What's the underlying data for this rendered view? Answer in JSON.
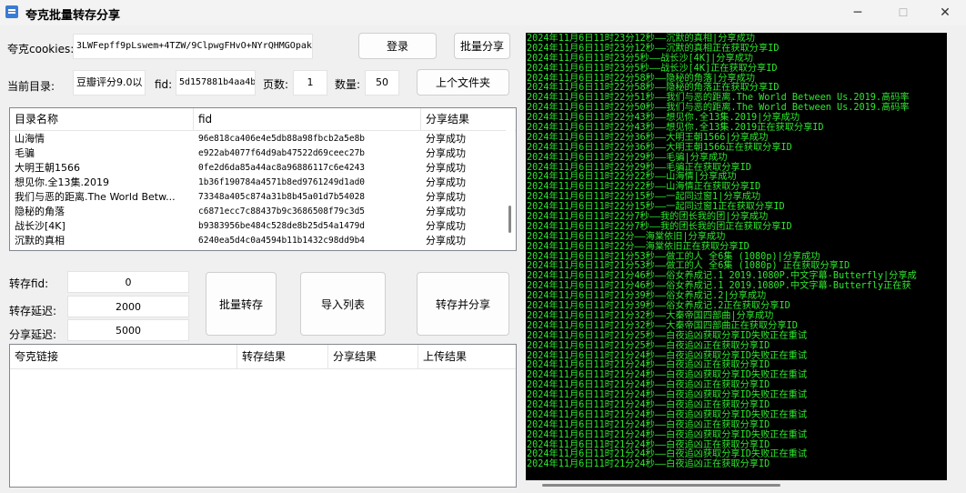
{
  "window": {
    "title": "夸克批量转存分享",
    "minimize": "─",
    "maximize": "☐",
    "close": "✕"
  },
  "login": {
    "cookies_label": "夸克cookies:",
    "cookies_value": "3LWFepff9pLswem+4TZW/9ClpwgFHvO+NYrQHMGOpak",
    "login_button": "登录",
    "batch_share_button": "批量分享"
  },
  "dir": {
    "current_label": "当前目录:",
    "current_value": "豆瓣评分9.0以",
    "fid_label": "fid:",
    "fid_value": "5d157881b4aa4b",
    "pages_label": "页数:",
    "pages_value": "1",
    "count_label": "数量:",
    "count_value": "50",
    "parent_button": "上个文件夹"
  },
  "file_table": {
    "headers": [
      "目录名称",
      "fid",
      "分享结果"
    ],
    "rows": [
      {
        "name": "山海情",
        "fid": "96e818ca406e4e5db88a98fbcb2a5e8b",
        "result": "分享成功"
      },
      {
        "name": "毛骗",
        "fid": "e922ab4077f64d9ab47522d69ceec27b",
        "result": "分享成功"
      },
      {
        "name": "大明王朝1566",
        "fid": "0fe2d6da85a44ac8a96886117c6e4243",
        "result": "分享成功"
      },
      {
        "name": "想见你.全13集.2019",
        "fid": "1b36f190784a4571b8ed9761249d1ad0",
        "result": "分享成功"
      },
      {
        "name": "我们与恶的距离.The World Betw...",
        "fid": "73348a405c874a31b8b45a01d7b54028",
        "result": "分享成功"
      },
      {
        "name": "隐秘的角落",
        "fid": "c6871ecc7c88437b9c3686508f79c3d5",
        "result": "分享成功"
      },
      {
        "name": "战长沙[4K]",
        "fid": "b9383956be484c528de8b25d54a1479d",
        "result": "分享成功"
      },
      {
        "name": "沉默的真相",
        "fid": "6240ea5d4c0a4594b11b1432c98dd9b4",
        "result": "分享成功"
      }
    ]
  },
  "transfer": {
    "fid_label": "转存fid:",
    "fid_value": "0",
    "delay_label": "转存延迟:",
    "delay_value": "2000",
    "share_delay_label": "分享延迟:",
    "share_delay_value": "5000",
    "batch_transfer_button": "批量转存",
    "import_button": "导入列表",
    "transfer_share_button": "转存并分享"
  },
  "link_table": {
    "headers": [
      "夸克链接",
      "转存结果",
      "分享结果",
      "上传结果"
    ]
  },
  "log": [
    "2024年11月6日11时23分12秒——沉默的真相|分享成功",
    "2024年11月6日11时23分12秒——沉默的真相正在获取分享ID",
    "2024年11月6日11时23分5秒——战长沙[4K]|分享成功",
    "2024年11月6日11时23分5秒——战长沙[4K]正在获取分享ID",
    "2024年11月6日11时22分58秒——隐秘的角落|分享成功",
    "2024年11月6日11时22分58秒——隐秘的角落正在获取分享ID",
    "2024年11月6日11时22分51秒——我们与恶的距离.The World Between Us.2019.高码率",
    "2024年11月6日11时22分50秒——我们与恶的距离.The World Between Us.2019.高码率",
    "2024年11月6日11时22分43秒——想见你.全13集.2019|分享成功",
    "2024年11月6日11时22分43秒——想见你.全13集.2019正在获取分享ID",
    "2024年11月6日11时22分36秒——大明王朝1566|分享成功",
    "2024年11月6日11时22分36秒——大明王朝1566正在获取分享ID",
    "2024年11月6日11时22分29秒——毛骗|分享成功",
    "2024年11月6日11时22分29秒——毛骗正在获取分享ID",
    "2024年11月6日11时22分22秒——山海情|分享成功",
    "2024年11月6日11时22分22秒——山海情正在获取分享ID",
    "2024年11月6日11时22分15秒——一起同过窗1|分享成功",
    "2024年11月6日11时22分15秒——一起同过窗1正在获取分享ID",
    "2024年11月6日11时22分7秒——我的团长我的团|分享成功",
    "2024年11月6日11时22分7秒——我的团长我的团正在获取分享ID",
    "2024年11月6日11时22分——海棠依旧|分享成功",
    "2024年11月6日11时22分——海棠依旧正在获取分享ID",
    "2024年11月6日11时21分53秒——做工的人 全6集 (1080p)|分享成功",
    "2024年11月6日11时21分53秒——做工的人 全6集 (1080p) 正在获取分享ID",
    "2024年11月6日11时21分46秒——俗女养成记.1 2019.1080P.中文字幕-Butterfly|分享成",
    "2024年11月6日11时21分46秒——俗女养成记.1 2019.1080P.中文字幕-Butterfly正在获",
    "2024年11月6日11时21分39秒——俗女养成记.2|分享成功",
    "2024年11月6日11时21分39秒——俗女养成记.2正在获取分享ID",
    "2024年11月6日11时21分32秒——大秦帝国四部曲|分享成功",
    "2024年11月6日11时21分32秒——大秦帝国四部曲正在获取分享ID",
    "2024年11月6日11时21分25秒——白夜追凶获取分享ID失败正在重试",
    "2024年11月6日11时21分25秒——白夜追凶正在获取分享ID",
    "2024年11月6日11时21分24秒——白夜追凶获取分享ID失败正在重试",
    "2024年11月6日11时21分24秒——白夜追凶正在获取分享ID",
    "2024年11月6日11时21分24秒——白夜追凶获取分享ID失败正在重试",
    "2024年11月6日11时21分24秒——白夜追凶正在获取分享ID",
    "2024年11月6日11时21分24秒——白夜追凶获取分享ID失败正在重试",
    "2024年11月6日11时21分24秒——白夜追凶正在获取分享ID",
    "2024年11月6日11时21分24秒——白夜追凶获取分享ID失败正在重试",
    "2024年11月6日11时21分24秒——白夜追凶正在获取分享ID",
    "2024年11月6日11时21分24秒——白夜追凶获取分享ID失败正在重试",
    "2024年11月6日11时21分24秒——白夜追凶正在获取分享ID",
    "2024年11月6日11时21分24秒——白夜追凶获取分享ID失败正在重试",
    "2024年11月6日11时21分24秒——白夜追凶正在获取分享ID"
  ]
}
